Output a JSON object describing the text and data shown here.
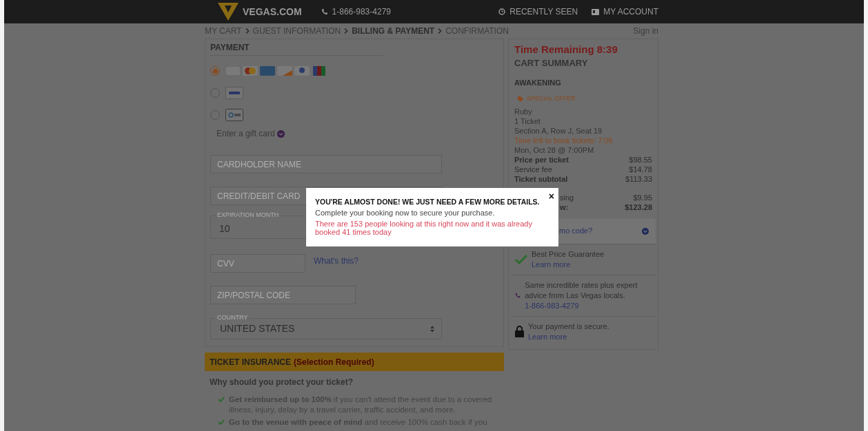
{
  "header": {
    "logo": "VEGAS.COM",
    "phone": "1-866-983-4279",
    "links": [
      {
        "label": "RECENTLY SEEN"
      },
      {
        "label": "MY ACCOUNT"
      }
    ]
  },
  "breadcrumb": {
    "steps": [
      {
        "label": "MY CART",
        "selected": false
      },
      {
        "label": "GUEST INFORMATION",
        "selected": false
      },
      {
        "label": "BILLING & PAYMENT",
        "selected": true
      },
      {
        "label": "CONFIRMATION",
        "selected": false
      }
    ],
    "sign_in": "Sign in"
  },
  "payment": {
    "title": "PAYMENT",
    "methods": [
      {
        "kind": "cards",
        "selected": true
      },
      {
        "kind": "paypal",
        "selected": false
      },
      {
        "kind": "gpay",
        "selected": false
      }
    ],
    "gift_card": "Enter a gift card",
    "cardholder": {
      "placeholder": "CARDHOLDER NAME"
    },
    "card_number": {
      "placeholder": "CREDIT/DEBIT CARD"
    },
    "expiration_month": {
      "label": "EXPIRATION MONTH",
      "value": "10"
    },
    "cvv": {
      "placeholder": "CVV",
      "help": "What's this?"
    },
    "zip": {
      "placeholder": "ZIP/POSTAL CODE"
    },
    "country": {
      "label": "COUNTRY",
      "value": "UNITED STATES"
    }
  },
  "insurance": {
    "title": "TICKET INSURANCE",
    "required": "(Selection Required)",
    "question": "Why should you protect your ticket?",
    "bullets": [
      "**Get reimbursed up to 100%** if you can't attend the event due to a covered illness, injury, delay by a travel carrier, traffic accident, and more.",
      "**Go to the venue with peace of mind** and receive 100% cash back if you"
    ]
  },
  "cart": {
    "timer": "Time Remaining 8:39",
    "title": "CART SUMMARY",
    "event": "AWAKENING",
    "offer": "SPECIAL OFFER",
    "details": [
      {
        "text": "Ruby",
        "kind": "plain"
      },
      {
        "text": "1 Ticket",
        "kind": "plain"
      },
      {
        "text": "Section A, Row J, Seat 19",
        "kind": "plain"
      },
      {
        "text": "Time left to book tickets: 7:05",
        "kind": "alert"
      },
      {
        "text": "Mon, Oct 28 @ 7:00PM",
        "kind": "plain"
      }
    ],
    "prices": [
      {
        "label": "Price per ticket",
        "value": "$98.55",
        "bold": true
      },
      {
        "label": "Service fee",
        "value": "$14.78",
        "bold": false
      },
      {
        "label": "Ticket subtotal",
        "value": "$113.33",
        "bold": true
      }
    ],
    "totals": [
      {
        "label": "sing",
        "value": "$9.95",
        "bold": false
      },
      {
        "label": "w:",
        "value": "$123.28",
        "bold": true
      }
    ],
    "promo": "mo code?",
    "info": [
      {
        "text": "Best Price Guarantee",
        "link": "Learn more"
      },
      {
        "text": "Same incredible rates plus expert advice from Las Vegas locals.",
        "link": "1-866-983-4279"
      },
      {
        "text": "Your payment is secure.",
        "link": "Learn more"
      }
    ]
  },
  "modal": {
    "title": "YOU'RE ALMOST DONE! WE JUST NEED A FEW MORE DETAILS.",
    "message": "Complete your booking now to secure your purchase.",
    "alert": "There are 153 people looking at this right now and it was already booked 41 times today",
    "close": "×"
  }
}
